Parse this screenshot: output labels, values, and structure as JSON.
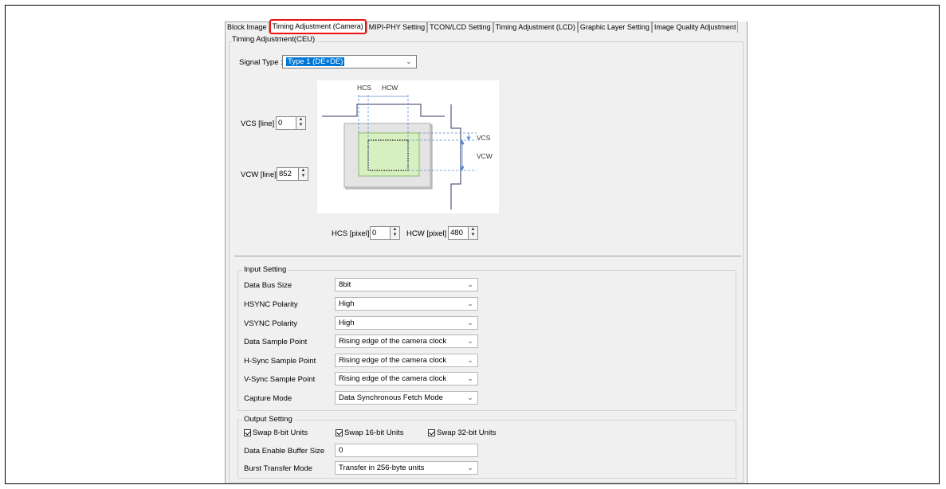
{
  "tabs": [
    {
      "label": "Block Image"
    },
    {
      "label": "Timing Adjustment (Camera)"
    },
    {
      "label": "MIPI-PHY Setting"
    },
    {
      "label": "TCON/LCD Setting"
    },
    {
      "label": "Timing Adjustment (LCD)"
    },
    {
      "label": "Graphic Layer Setting"
    },
    {
      "label": "Image Quality Adjustment"
    }
  ],
  "panel_title": "Timing Adjustment(CEU)",
  "signal_type": {
    "label": "Signal Type :",
    "value": "Type 1 (DE+DE)"
  },
  "vcs": {
    "label": "VCS [line]",
    "value": "0"
  },
  "vcw": {
    "label": "VCW [line]",
    "value": "852"
  },
  "hcs": {
    "label": "HCS [pixel]",
    "value": "0"
  },
  "hcw": {
    "label": "HCW [pixel]",
    "value": "480"
  },
  "diagram": {
    "hcs": "HCS",
    "hcw": "HCW",
    "vcs": "VCS",
    "vcw": "VCW"
  },
  "input_setting": {
    "title": "Input Setting",
    "rows": [
      {
        "label": "Data Bus Size",
        "value": "8bit"
      },
      {
        "label": "HSYNC Polarity",
        "value": "High"
      },
      {
        "label": "VSYNC Polarity",
        "value": "High"
      },
      {
        "label": "Data Sample Point",
        "value": "Rising edge of the camera clock"
      },
      {
        "label": "H-Sync Sample Point",
        "value": "Rising edge of the camera clock"
      },
      {
        "label": "V-Sync Sample Point",
        "value": "Rising edge of the camera clock"
      },
      {
        "label": "Capture Mode",
        "value": "Data Synchronous Fetch Mode"
      }
    ]
  },
  "output_setting": {
    "title": "Output Setting",
    "swap8": "Swap 8-bit Units",
    "swap16": "Swap 16-bit Units",
    "swap32": "Swap 32-bit Units",
    "buffer_label": "Data Enable Buffer Size",
    "buffer_value": "0",
    "burst_label": "Burst Transfer Mode",
    "burst_value": "Transfer in 256-byte units"
  },
  "colors": {
    "highlight": "#e11111",
    "selected": "#0078d7",
    "diagram_fill": "#d8f0c0"
  }
}
